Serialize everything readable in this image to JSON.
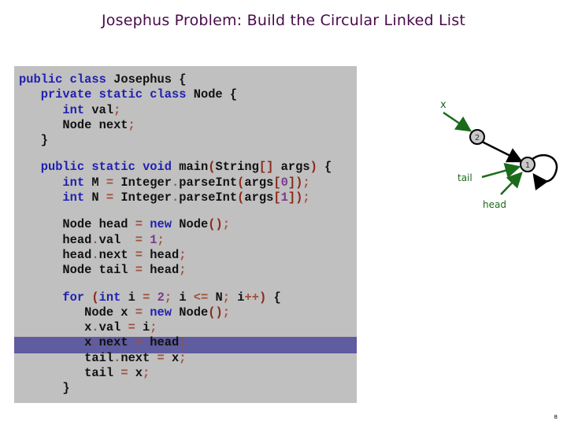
{
  "title": "Josephus Problem:  Build the Circular Linked List",
  "code": {
    "lines": [
      "public class Josephus {",
      "   private static class Node {",
      "      int val;",
      "      Node next;",
      "   }",
      "",
      "   public static void main(String[] args) {",
      "      int M = Integer.parseInt(args[0]);",
      "      int N = Integer.parseInt(args[1]);",
      "",
      "      Node head = new Node();",
      "      head.val  = 1;",
      "      head.next = head;",
      "      Node tail = head;",
      "",
      "      for (int i = 2; i <= N; i++) {",
      "         Node x = new Node();",
      "         x.val = i;",
      "         x.next = head;",
      "         tail.next = x;",
      "         tail = x;",
      "      }"
    ],
    "highlighted_line": "x.next = head;"
  },
  "diagram": {
    "nodes": [
      {
        "label": "2"
      },
      {
        "label": "1"
      }
    ],
    "pointers": [
      {
        "label": "x",
        "target": "2"
      },
      {
        "label": "tail",
        "target": "1"
      },
      {
        "label": "head",
        "target": "1"
      }
    ],
    "colors": {
      "pointer": "#1a6b1a",
      "node_fill": "#c8c8c8",
      "edge": "#000000",
      "highlight": "#5f5ca0"
    }
  },
  "page_number": "8"
}
